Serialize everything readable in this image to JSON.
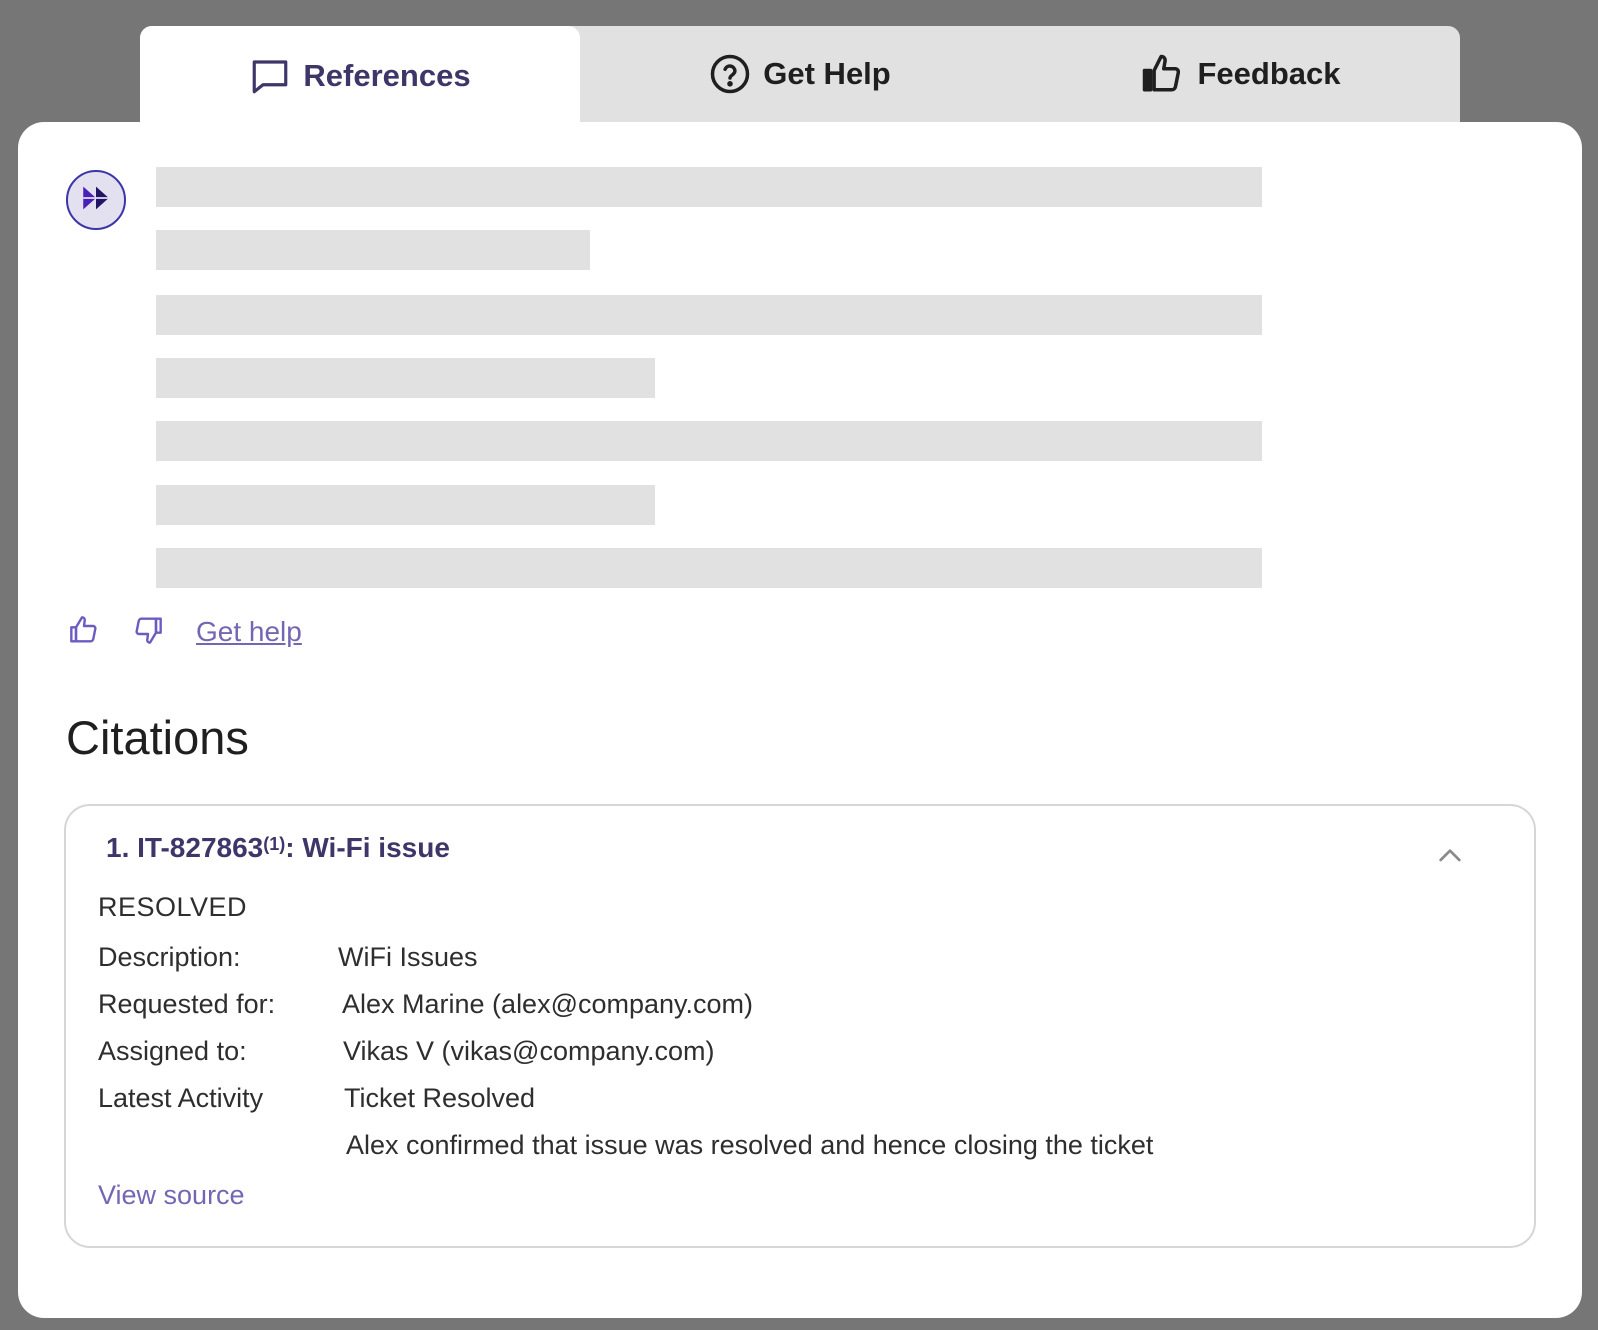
{
  "tabs": {
    "references": "References",
    "get_help": "Get Help",
    "feedback": "Feedback"
  },
  "actions": {
    "get_help_link": "Get help"
  },
  "citations": {
    "title": "Citations",
    "items": [
      {
        "number": "1.",
        "ticket_id": "IT-827863",
        "ref_marker": "(1)",
        "subject": ": Wi-Fi issue",
        "status": "RESOLVED",
        "fields": {
          "description_label": "Description:",
          "description_value": "WiFi Issues",
          "requested_for_label": "Requested for:",
          "requested_for_value": "Alex Marine (alex@company.com)",
          "assigned_to_label": "Assigned to:",
          "assigned_to_value": "Vikas V (vikas@company.com)",
          "latest_activity_label": "Latest Activity",
          "latest_activity_value": "Ticket Resolved",
          "latest_activity_detail": "Alex confirmed that issue was resolved and hence closing the ticket"
        },
        "view_source": "View source"
      }
    ]
  },
  "colors": {
    "accent": "#3e3569",
    "link": "#7566b4",
    "backdrop": "#767676",
    "skeleton": "#e1e1e1"
  },
  "icons": {
    "references": "chat-bubble-icon",
    "get_help": "help-circle-icon",
    "feedback": "thumbs-up-icon",
    "avatar": "fast-forward-icon",
    "thumbs_up": "thumbs-up-icon",
    "thumbs_down": "thumbs-down-icon",
    "collapse": "chevron-up-icon"
  }
}
